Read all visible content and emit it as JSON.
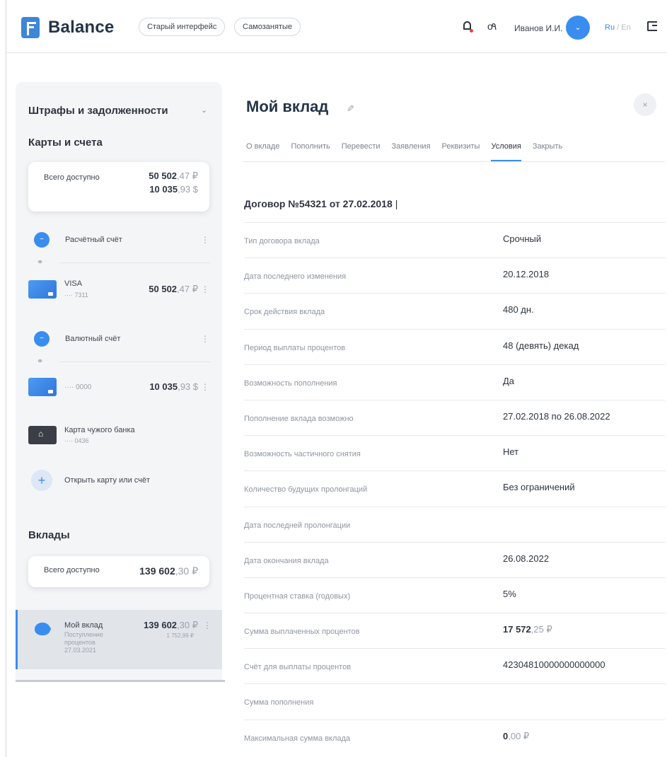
{
  "header": {
    "logo_text": "Balance",
    "old_interface_label": "Старый интерфейс",
    "self_employed_label": "Самозанятые",
    "username": "Иванов И.И.",
    "lang_ru": "Ru",
    "lang_sep": " / ",
    "lang_en": "En"
  },
  "sidebar": {
    "fines_heading": "Штрафы и задолженности",
    "cards_heading": "Карты и счета",
    "cards_total_label": "Всего доступно",
    "cards_total_rub_int": "50 502",
    "cards_total_rub_frac": ",47 ₽",
    "cards_total_usd_int": "10 035",
    "cards_total_usd_frac": ",93 $",
    "settlement_account": "Расчётный счёт",
    "visa_name": "VISA",
    "visa_number": "···· 7311",
    "visa_amount_int": "50 502",
    "visa_amount_frac": ",47 ₽",
    "currency_account": "Валютный счёт",
    "usd_card_number": "···· 0000",
    "usd_card_amount_int": "10 035",
    "usd_card_amount_frac": ",93 $",
    "other_bank_card": "Карта чужого банка",
    "other_bank_number": "···· 0436",
    "open_label": "Открыть карту или счёт",
    "deposits_heading": "Вклады",
    "deposits_total_label": "Всего доступно",
    "deposits_total_int": "139 602",
    "deposits_total_frac": ",30 ₽",
    "deposit_name": "Мой вклад",
    "deposit_sub": "Поступление процентов 27.03.2021",
    "deposit_amount_int": "139 602",
    "deposit_amount_frac": ",30 ₽",
    "deposit_income": "1 752,99 ₽"
  },
  "main": {
    "title": "Мой вклад",
    "tabs": [
      "О вкладе",
      "Пополнить",
      "Перевести",
      "Заявления",
      "Реквизиты",
      "Условия",
      "Закрыть"
    ],
    "active_tab": "Условия",
    "contract_title": "Договор №54321 от 27.02.2018",
    "contract_bar": "|",
    "rows": [
      {
        "label": "Тип договора вклада",
        "value": "Срочный"
      },
      {
        "label": "Дата последнего изменения",
        "value": "20.12.2018"
      },
      {
        "label": "Срок действия вклада",
        "value": "480 дн."
      },
      {
        "label": "Период выплаты процентов",
        "value": "48 (девять) декад"
      },
      {
        "label": "Возможность пополнения",
        "value": "Да"
      },
      {
        "label": "Пополнение вклада возможно",
        "value": "27.02.2018 по 26.08.2022"
      },
      {
        "label": "Возможность частичного снятия",
        "value": "Нет"
      },
      {
        "label": "Количество будущих пролонгаций",
        "value": "Без ограничений"
      },
      {
        "label": "Дата последней пролонгации",
        "value": ""
      },
      {
        "label": "Дата окончания вклада",
        "value": "26.08.2022"
      },
      {
        "label": "Процентная ставка (годовых)",
        "value": "5%"
      },
      {
        "label": "Сумма выплаченных процентов",
        "value_int": "17 572",
        "value_frac": ",25 ₽"
      },
      {
        "label": "Счёт для выплаты процентов",
        "value": "42304810000000000000"
      },
      {
        "label": "Сумма пополнения",
        "value": ""
      },
      {
        "label": "Максимальная сумма вклада",
        "value_int": "0",
        "value_frac": ",00 ₽"
      }
    ]
  }
}
